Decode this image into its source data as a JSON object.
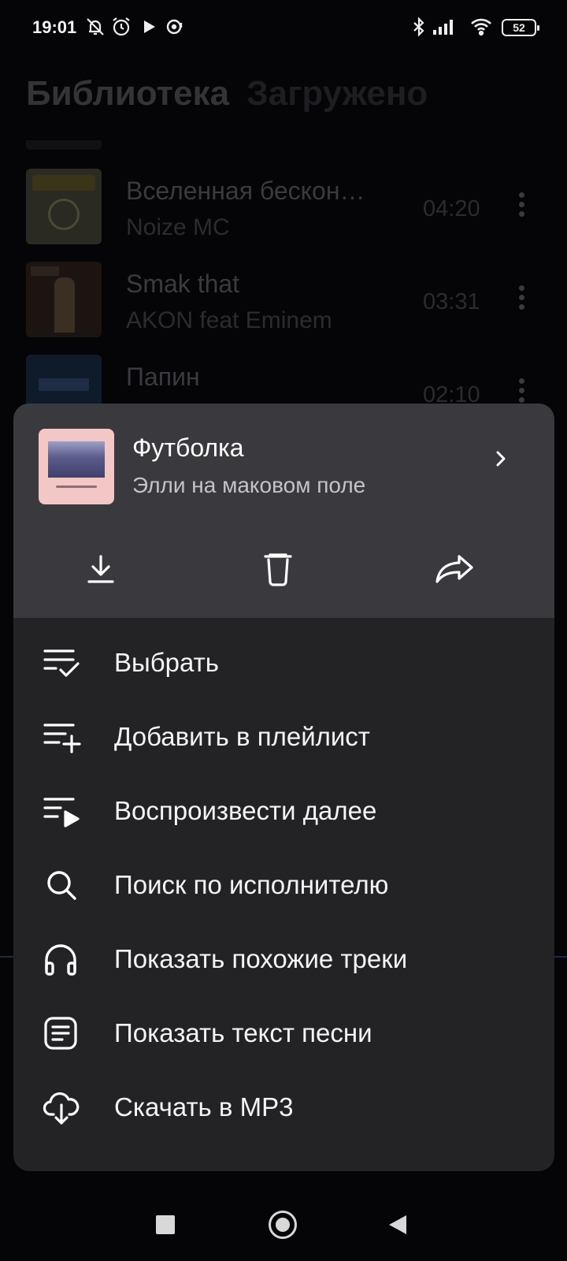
{
  "status": {
    "time": "19:01",
    "battery": "52"
  },
  "library": {
    "tabs": [
      "Библиотека",
      "Загружено"
    ],
    "tracks": [
      {
        "title": "Вселенная бескон…",
        "artist": "Noize MC",
        "duration": "04:20"
      },
      {
        "title": "Smak that",
        "artist": "AKON feat Eminem",
        "duration": "03:31"
      },
      {
        "title": "Папин",
        "artist": "",
        "duration": "02:10"
      }
    ]
  },
  "sheet": {
    "title": "Футболка",
    "artist": "Элли на маковом поле",
    "actions": [
      "download-icon",
      "trash-icon",
      "share-icon"
    ],
    "menu": [
      {
        "label": "Выбрать",
        "icon": "select-list-icon"
      },
      {
        "label": "Добавить в плейлист",
        "icon": "playlist-add-icon"
      },
      {
        "label": "Воспроизвести далее",
        "icon": "play-next-icon"
      },
      {
        "label": "Поиск по исполнителю",
        "icon": "search-icon"
      },
      {
        "label": "Показать похожие треки",
        "icon": "headphones-icon"
      },
      {
        "label": "Показать текст песни",
        "icon": "lyrics-icon"
      },
      {
        "label": "Скачать в MP3",
        "icon": "cloud-download-icon"
      }
    ]
  },
  "colors": {
    "sheet_bg": "#232326",
    "sheet_head_bg": "#3a3a3e",
    "page_bg": "#050507"
  }
}
